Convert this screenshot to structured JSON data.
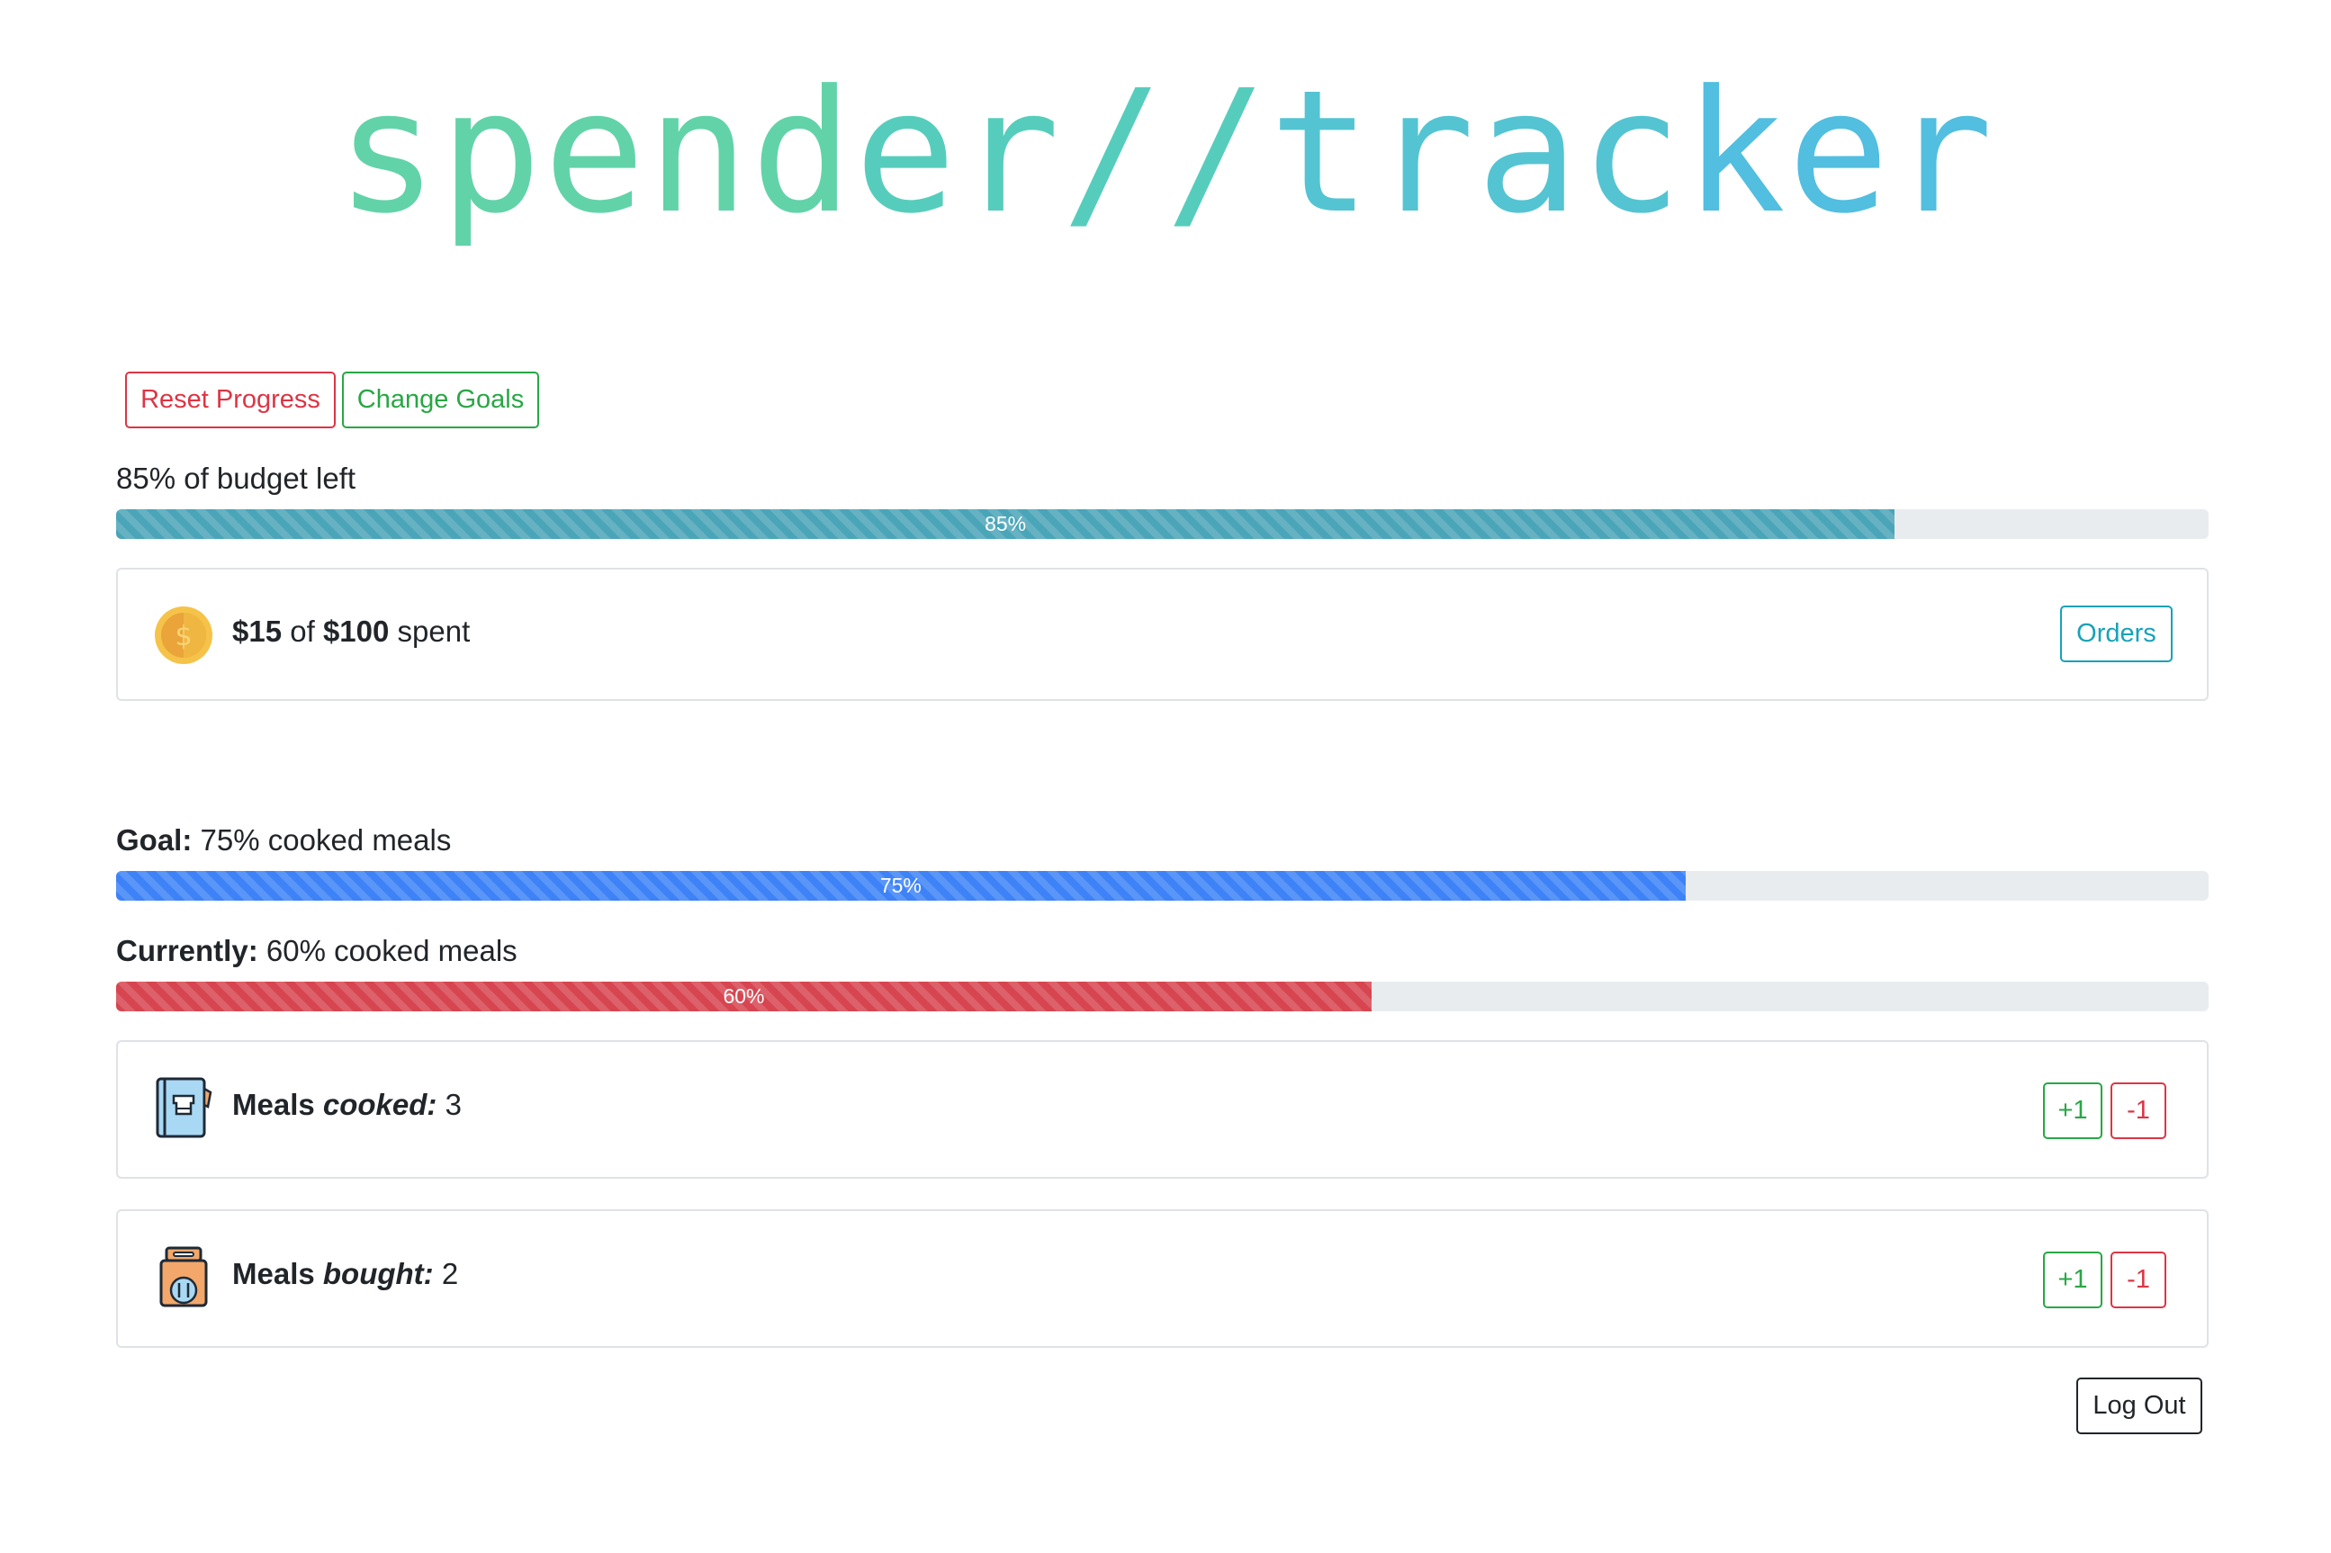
{
  "app": {
    "logo_part1": "spend",
    "logo_part2": "er//",
    "logo_part3": "trac",
    "logo_part4": "ker"
  },
  "toolbar": {
    "reset_label": "Reset Progress",
    "change_goals_label": "Change Goals"
  },
  "budget": {
    "left_label": "85% of budget left",
    "progress_value": 85,
    "progress_text": "85%",
    "spent_amount": "$15",
    "of_word": "of",
    "total_amount": "$100",
    "spent_word": "spent",
    "orders_label": "Orders",
    "icon": "coin-icon"
  },
  "goal": {
    "goal_prefix": "Goal:",
    "goal_text": "75% cooked meals",
    "goal_value": 75,
    "goal_progress_text": "75%",
    "current_prefix": "Currently:",
    "current_text": "60% cooked meals",
    "current_value": 60,
    "current_progress_text": "60%"
  },
  "meals": {
    "cooked": {
      "prefix": "Meals",
      "emphasis": "cooked:",
      "count": "3",
      "icon": "recipe-book-icon",
      "plus_label": "+1",
      "minus_label": "-1"
    },
    "bought": {
      "prefix": "Meals",
      "emphasis": "bought:",
      "count": "2",
      "icon": "takeout-bag-icon",
      "plus_label": "+1",
      "minus_label": "-1"
    }
  },
  "footer": {
    "logout_label": "Log Out"
  },
  "colors": {
    "danger": "#dc3545",
    "success": "#28a745",
    "info": "#17a2b8",
    "primary_bar": "#3d82f7",
    "budget_bar": "#4ba5b8",
    "current_bar": "#d64550"
  }
}
